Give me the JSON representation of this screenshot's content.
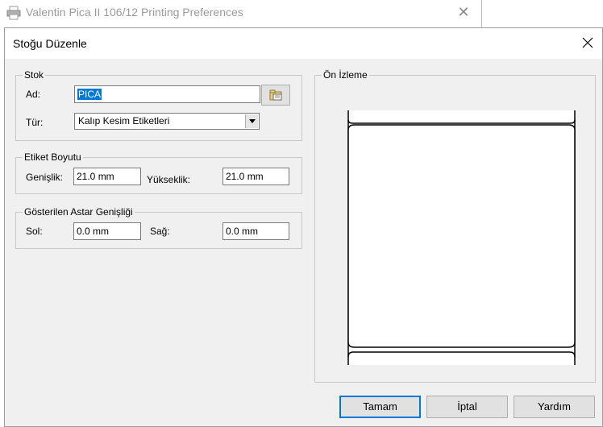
{
  "background_window": {
    "title": "Valentin Pica II 106/12 Printing Preferences",
    "icon": "printer-icon"
  },
  "dialog": {
    "title": "Stoğu Düzenle"
  },
  "stock_group": {
    "legend": "Stok",
    "name_label": "Ad:",
    "name_value": "PICA",
    "type_label": "Tür:",
    "type_value": "Kalıp Kesim Etiketleri",
    "browse_icon": "folder-browse-icon"
  },
  "label_size_group": {
    "legend": "Etiket Boyutu",
    "width_label": "Genişlik:",
    "width_value": "21.0 mm",
    "height_label": "Yükseklik:",
    "height_value": "21.0 mm"
  },
  "liner_group": {
    "legend": "Gösterilen Astar Genişliği",
    "left_label": "Sol:",
    "left_value": "0.0 mm",
    "right_label": "Sağ:",
    "right_value": "0.0 mm"
  },
  "preview_group": {
    "legend": "Ön İzleme"
  },
  "buttons": {
    "ok": "Tamam",
    "cancel": "İptal",
    "help": "Yardım"
  },
  "colors": {
    "accent": "#0078d7",
    "dialog_bg": "#f0f0f0"
  }
}
